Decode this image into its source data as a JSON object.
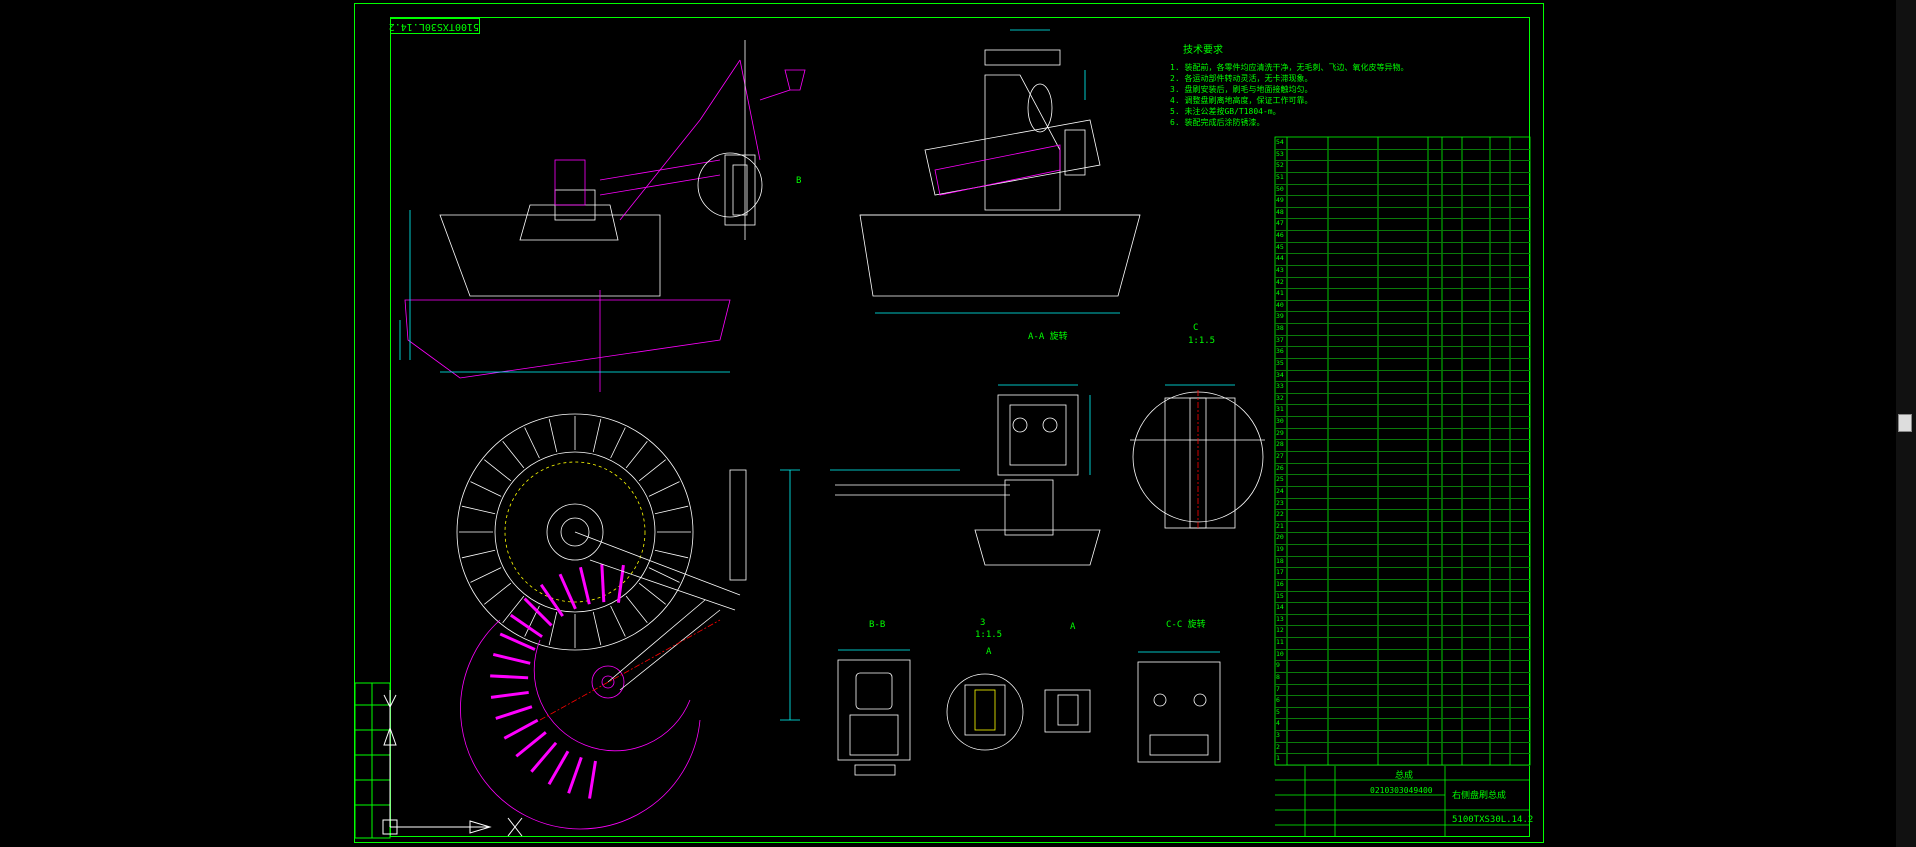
{
  "drawing": {
    "rotated_stamp": "5100TXS30L.14.2",
    "drawing_number": "5100TXS30L.14.2",
    "drawing_name": "右侧盘刷总成",
    "material_code": "0210303049400",
    "title_label": "总成"
  },
  "notes": {
    "title": "技术要求",
    "lines": [
      "1. 装配前，各零件均应清洗干净，无毛刺、飞边、氧化皮等异物。",
      "2. 各运动部件转动灵活，无卡滞现象。",
      "3. 盘刷安装后，刷毛与地面接触均匀。",
      "4. 调整盘刷离地高度，保证工作可靠。",
      "5. 未注公差按GB/T1804-m。",
      "6. 装配完成后涂防锈漆。"
    ]
  },
  "section_labels": {
    "b_mark": "B",
    "a_a": "A-A 旋转",
    "c_scale_top": "C",
    "c_scale_bottom": "1:1.5",
    "b_b": "B-B",
    "a_scale_top": "3",
    "a_scale_bottom": "1:1.5",
    "a_view": "A",
    "c_c": "C-C 旋转",
    "detail_a": "A"
  },
  "bom": {
    "rows": [
      [
        "54",
        "",
        ""
      ],
      [
        "53",
        "",
        ""
      ],
      [
        "52",
        "",
        ""
      ],
      [
        "51",
        "",
        ""
      ],
      [
        "50",
        "",
        ""
      ],
      [
        "49",
        "",
        ""
      ],
      [
        "48",
        "",
        ""
      ],
      [
        "47",
        "",
        ""
      ],
      [
        "46",
        "",
        ""
      ],
      [
        "45",
        "",
        ""
      ],
      [
        "44",
        "",
        ""
      ],
      [
        "43",
        "",
        ""
      ],
      [
        "42",
        "",
        ""
      ],
      [
        "41",
        "",
        ""
      ],
      [
        "40",
        "",
        ""
      ],
      [
        "39",
        "",
        ""
      ],
      [
        "38",
        "",
        ""
      ],
      [
        "37",
        "",
        ""
      ],
      [
        "36",
        "",
        ""
      ],
      [
        "35",
        "",
        ""
      ],
      [
        "34",
        "",
        ""
      ],
      [
        "33",
        "",
        ""
      ],
      [
        "32",
        "",
        ""
      ],
      [
        "31",
        "",
        ""
      ],
      [
        "30",
        "",
        ""
      ],
      [
        "29",
        "",
        ""
      ],
      [
        "28",
        "",
        ""
      ],
      [
        "27",
        "",
        ""
      ],
      [
        "26",
        "",
        ""
      ],
      [
        "25",
        "",
        ""
      ],
      [
        "24",
        "",
        ""
      ],
      [
        "23",
        "",
        ""
      ],
      [
        "22",
        "",
        ""
      ],
      [
        "21",
        "",
        ""
      ],
      [
        "20",
        "",
        ""
      ],
      [
        "19",
        "",
        ""
      ],
      [
        "18",
        "",
        ""
      ],
      [
        "17",
        "",
        ""
      ],
      [
        "16",
        "",
        ""
      ],
      [
        "15",
        "",
        ""
      ],
      [
        "14",
        "",
        ""
      ],
      [
        "13",
        "",
        ""
      ],
      [
        "12",
        "",
        ""
      ],
      [
        "11",
        "",
        ""
      ],
      [
        "10",
        "",
        ""
      ],
      [
        "9",
        "",
        ""
      ],
      [
        "8",
        "",
        ""
      ],
      [
        "7",
        "",
        ""
      ],
      [
        "6",
        "",
        ""
      ],
      [
        "5",
        "",
        ""
      ],
      [
        "4",
        "",
        ""
      ],
      [
        "3",
        "",
        ""
      ],
      [
        "2",
        "",
        ""
      ],
      [
        "1",
        "",
        ""
      ]
    ]
  },
  "colors": {
    "background": "#000000",
    "frame": "#00ff00",
    "geometry": "#ffffff",
    "brush": "#ff00ff",
    "dim": "#00ffff",
    "center": "#ff0000",
    "hidden": "#ffff00"
  }
}
